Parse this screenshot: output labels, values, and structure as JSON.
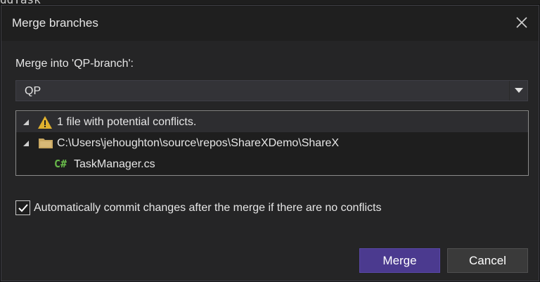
{
  "dialog": {
    "title": "Merge branches",
    "merge_into_label": "Merge into 'QP-branch':",
    "source_branch": "QP",
    "tree": [
      {
        "level": 0,
        "icon": "warning-icon",
        "text": "1 file with potential conflicts.",
        "expanded": true
      },
      {
        "level": 1,
        "icon": "folder-icon",
        "text": "C:\\Users\\jehoughton\\source\\repos\\ShareXDemo\\ShareX",
        "expanded": true
      },
      {
        "level": 2,
        "icon": "csharp-file-icon",
        "text": "TaskManager.cs",
        "expanded": false
      }
    ],
    "auto_commit": {
      "checked": true,
      "label": "Automatically commit changes after the merge if there are no conflicts"
    },
    "buttons": {
      "merge": "Merge",
      "cancel": "Cancel"
    }
  },
  "colors": {
    "accent": "#4b3a8f",
    "warning": "#e0b12e",
    "folder": "#c9a862",
    "csharp": "#68b94a"
  }
}
